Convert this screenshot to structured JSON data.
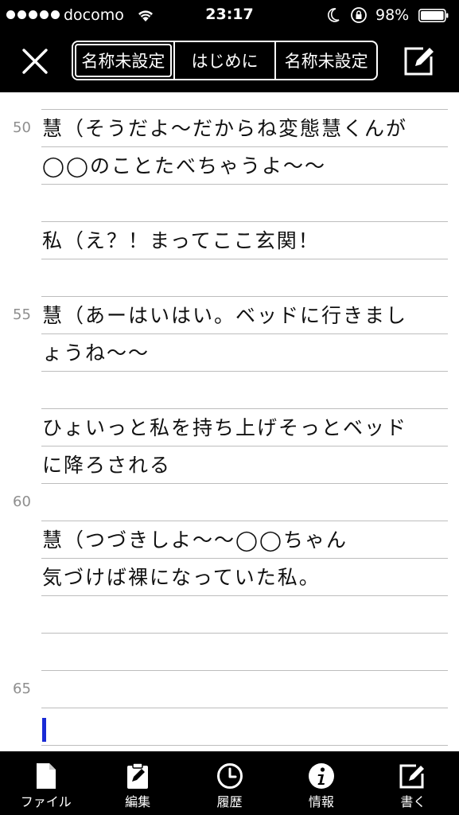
{
  "status_bar": {
    "carrier": "docomo",
    "time": "23:17",
    "battery": "98%"
  },
  "nav": {
    "tabs": [
      {
        "label": "名称未設定"
      },
      {
        "label": "はじめに"
      },
      {
        "label": "名称未設定"
      }
    ],
    "close_icon": "close-icon",
    "edit_icon": "compose-icon"
  },
  "editor": {
    "lines": [
      {
        "num": "",
        "text": ""
      },
      {
        "num": "50",
        "text": "慧（そうだよ〜だからね変態慧くんが"
      },
      {
        "num": "",
        "text": "◯◯のことたべちゃうよ〜〜"
      },
      {
        "num": "",
        "text": ""
      },
      {
        "num": "",
        "text": "私（え？！まってここ玄関！"
      },
      {
        "num": "",
        "text": ""
      },
      {
        "num": "55",
        "text": "慧（あーはいはい。ベッドに行きまし"
      },
      {
        "num": "",
        "text": "ょうね〜〜"
      },
      {
        "num": "",
        "text": ""
      },
      {
        "num": "",
        "text": "ひょいっと私を持ち上げそっとベッド"
      },
      {
        "num": "",
        "text": "に降ろされる"
      },
      {
        "num": "60",
        "text": ""
      },
      {
        "num": "",
        "text": "慧（つづきしよ〜〜◯◯ちゃん"
      },
      {
        "num": "",
        "text": "気づけば裸になっていた私。"
      },
      {
        "num": "",
        "text": ""
      },
      {
        "num": "",
        "text": ""
      },
      {
        "num": "65",
        "text": ""
      },
      {
        "num": "",
        "text": ""
      }
    ]
  },
  "toolbar": {
    "items": [
      {
        "label": "ファイル",
        "icon": "file-icon"
      },
      {
        "label": "編集",
        "icon": "clipboard-icon"
      },
      {
        "label": "履歴",
        "icon": "clock-icon"
      },
      {
        "label": "情報",
        "icon": "info-icon"
      },
      {
        "label": "書く",
        "icon": "compose-icon"
      }
    ]
  }
}
